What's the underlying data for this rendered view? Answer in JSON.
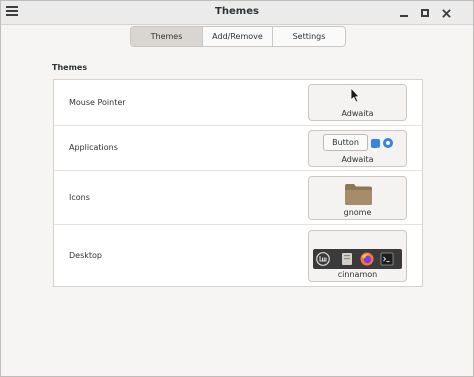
{
  "window": {
    "title": "Themes"
  },
  "tabs": [
    {
      "label": "Themes",
      "active": true
    },
    {
      "label": "Add/Remove",
      "active": false
    },
    {
      "label": "Settings",
      "active": false
    }
  ],
  "section": {
    "title": "Themes"
  },
  "rows": [
    {
      "label": "Mouse Pointer",
      "value": "Adwaita"
    },
    {
      "label": "Applications",
      "value": "Adwaita",
      "preview_button": "Button"
    },
    {
      "label": "Icons",
      "value": "gnome"
    },
    {
      "label": "Desktop",
      "value": "cinnamon"
    }
  ],
  "colors": {
    "accent": "#3584e4",
    "folder": "#a58d6a",
    "panel_dark": "#3a3a3a"
  },
  "icons": [
    "menu-icon",
    "minimize-icon",
    "maximize-icon",
    "close-icon",
    "mouse-pointer-icon",
    "folder-icon",
    "mint-menu-icon",
    "files-icon",
    "firefox-icon",
    "terminal-icon"
  ]
}
